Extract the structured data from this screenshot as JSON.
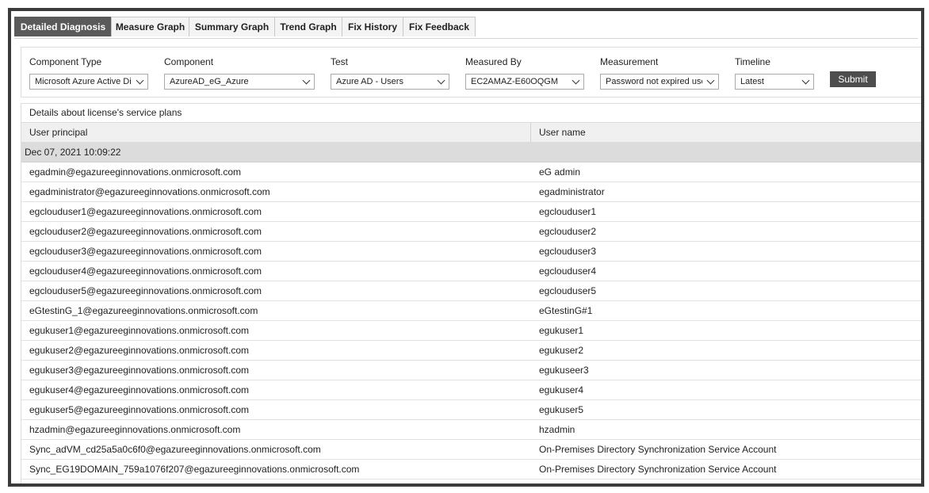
{
  "tabs": [
    {
      "label": "Detailed Diagnosis",
      "active": true
    },
    {
      "label": "Measure Graph",
      "active": false
    },
    {
      "label": "Summary Graph",
      "active": false
    },
    {
      "label": "Trend Graph",
      "active": false
    },
    {
      "label": "Fix History",
      "active": false
    },
    {
      "label": "Fix Feedback",
      "active": false
    }
  ],
  "filters": {
    "component_type": {
      "label": "Component Type",
      "value": "Microsoft Azure Active Directory"
    },
    "component": {
      "label": "Component",
      "value": "AzureAD_eG_Azure"
    },
    "test": {
      "label": "Test",
      "value": "Azure AD - Users"
    },
    "measured_by": {
      "label": "Measured By",
      "value": "EC2AMAZ-E60OQGM"
    },
    "measurement": {
      "label": "Measurement",
      "value": "Password not expired users"
    },
    "timeline": {
      "label": "Timeline",
      "value": "Latest"
    },
    "submit_label": "Submit"
  },
  "table": {
    "caption": "Details about license's service plans",
    "headers": {
      "user_principal": "User principal",
      "user_name": "User name"
    },
    "group_timestamp": "Dec 07, 2021 10:09:22",
    "rows": [
      {
        "principal": "egadmin@egazureeginnovations.onmicrosoft.com",
        "name": "eG admin"
      },
      {
        "principal": "egadministrator@egazureeginnovations.onmicrosoft.com",
        "name": "egadministrator"
      },
      {
        "principal": "egclouduser1@egazureeginnovations.onmicrosoft.com",
        "name": "egclouduser1"
      },
      {
        "principal": "egclouduser2@egazureeginnovations.onmicrosoft.com",
        "name": "egclouduser2"
      },
      {
        "principal": "egclouduser3@egazureeginnovations.onmicrosoft.com",
        "name": "egclouduser3"
      },
      {
        "principal": "egclouduser4@egazureeginnovations.onmicrosoft.com",
        "name": "egclouduser4"
      },
      {
        "principal": "egclouduser5@egazureeginnovations.onmicrosoft.com",
        "name": "egclouduser5"
      },
      {
        "principal": "eGtestinG_1@egazureeginnovations.onmicrosoft.com",
        "name": "eGtestinG#1"
      },
      {
        "principal": "egukuser1@egazureeginnovations.onmicrosoft.com",
        "name": "egukuser1"
      },
      {
        "principal": "egukuser2@egazureeginnovations.onmicrosoft.com",
        "name": "egukuser2"
      },
      {
        "principal": "egukuser3@egazureeginnovations.onmicrosoft.com",
        "name": "egukuseer3"
      },
      {
        "principal": "egukuser4@egazureeginnovations.onmicrosoft.com",
        "name": "egukuser4"
      },
      {
        "principal": "egukuser5@egazureeginnovations.onmicrosoft.com",
        "name": "egukuser5"
      },
      {
        "principal": "hzadmin@egazureeginnovations.onmicrosoft.com",
        "name": "hzadmin"
      },
      {
        "principal": "Sync_adVM_cd25a5a0c6f0@egazureeginnovations.onmicrosoft.com",
        "name": "On-Premises Directory Synchronization Service Account"
      },
      {
        "principal": "Sync_EG19DOMAIN_759a1076f207@egazureeginnovations.onmicrosoft.com",
        "name": "On-Premises Directory Synchronization Service Account"
      }
    ]
  }
}
